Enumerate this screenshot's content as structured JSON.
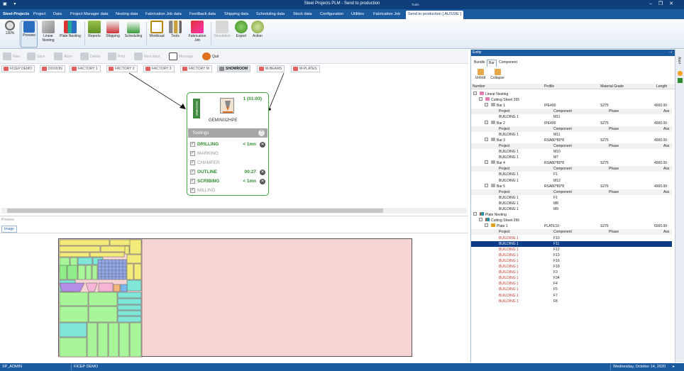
{
  "window": {
    "title": "Steel Projects PLM - Send to production",
    "context_title": "Tools",
    "controls": [
      "–",
      "❐",
      "✕"
    ]
  },
  "menu": {
    "app_tab": "Steel-Projects",
    "tabs": [
      "Project",
      "Data",
      "Project Manager data",
      "Nesting data",
      "Fabrication Job data",
      "Feedback data",
      "Shipping data",
      "Scheduling data",
      "Stock data",
      "Configuration",
      "Utilities",
      "Fabrication Job"
    ],
    "active_tab": "Send to production [ AUSSIE ]"
  },
  "ribbon": {
    "zoom": "130%",
    "buttons": [
      {
        "label": "Preview",
        "icon": "preview-icon"
      },
      {
        "label": "Linear Nesting",
        "icon": "linear-nesting-icon"
      },
      {
        "label": "Plate Nesting",
        "icon": "plate-nesting-icon"
      },
      {
        "label": "Reports",
        "icon": "reports-icon"
      },
      {
        "label": "Shipping",
        "icon": "shipping-icon"
      },
      {
        "label": "Scheduling",
        "icon": "scheduling-icon"
      },
      {
        "label": "Workload",
        "icon": "workload-icon"
      },
      {
        "label": "Tools",
        "icon": "tools-icon"
      },
      {
        "label": "Fabrication Job",
        "icon": "fabrication-job-icon"
      },
      {
        "label": "Simulation",
        "icon": "simulation-icon"
      },
      {
        "label": "Export",
        "icon": "export-icon"
      },
      {
        "label": "Action",
        "icon": "action-icon"
      }
    ]
  },
  "commands": [
    "New",
    "Save",
    "Abort",
    "Delete",
    "Print",
    "Next input",
    "Message",
    "Quit"
  ],
  "factory_tabs": [
    "FICEP DEMO",
    "DOXION",
    "FACTORY 1",
    "FACTORY 2",
    "FACTORY 3",
    "FACTORY M",
    "SHOWROOM",
    "M-BEAMS",
    "M-PLATES"
  ],
  "active_factory": "SHOWROOM",
  "machine": {
    "name": "GEMINI32HPE",
    "count": "1 (01:03)",
    "thumb_label": "MACHINE",
    "toolings_label": "Toolings",
    "toolings": [
      {
        "name": "DRILLING",
        "time": "< 1mn",
        "active": true
      },
      {
        "name": "MARKING",
        "time": "",
        "active": false
      },
      {
        "name": "CHAMFER",
        "time": "",
        "active": false
      },
      {
        "name": "OUTLINE",
        "time": "00:27",
        "active": true
      },
      {
        "name": "SCRIBING",
        "time": "< 1mn",
        "active": true
      },
      {
        "name": "MILLING",
        "time": "",
        "active": false
      }
    ]
  },
  "preview": {
    "label": "Preview",
    "tab": "Image"
  },
  "entity": {
    "title": "Entity",
    "tabs": [
      "Bundle",
      "Bar",
      "Component"
    ],
    "active_tab": "Bar",
    "buttons": [
      "Unfold",
      "Collapse"
    ],
    "columns": [
      "Number",
      "Profile",
      "Material Grade",
      "Length"
    ],
    "sub_columns": [
      "Project",
      "Component",
      "Phase",
      "Ass"
    ],
    "linear_nesting": "Linear Nesting",
    "cutting_sheet_1": "Cutting Sheet 265",
    "bars": [
      {
        "name": "Bar 1",
        "profile": "IPE400",
        "grade": "S275",
        "length": "4000.00",
        "items": [
          {
            "project": "BUILDING 1",
            "component": "M11"
          }
        ]
      },
      {
        "name": "Bar 2",
        "profile": "IPE400",
        "grade": "S275",
        "length": "4000.00",
        "items": [
          {
            "project": "BUILDING 1",
            "component": "M11"
          }
        ]
      },
      {
        "name": "Bar 3",
        "profile": "RSA80*80*8",
        "grade": "S275",
        "length": "4000.00",
        "items": [
          {
            "project": "BUILDING 1",
            "component": "M10"
          },
          {
            "project": "BUILDING 1",
            "component": "M7"
          }
        ]
      },
      {
        "name": "Bar 4",
        "profile": "RSA80*80*8",
        "grade": "S275",
        "length": "4000.00",
        "items": [
          {
            "project": "BUILDING 1",
            "component": "F1"
          },
          {
            "project": "BUILDING 1",
            "component": "M12"
          }
        ]
      },
      {
        "name": "Bar 5",
        "profile": "RSA80*80*8",
        "grade": "S275",
        "length": "4000.00",
        "items": [
          {
            "project": "BUILDING 1",
            "component": "F1"
          },
          {
            "project": "BUILDING 1",
            "component": "M8"
          },
          {
            "project": "BUILDING 1",
            "component": "M9"
          }
        ]
      }
    ],
    "plate_nesting": "Plate Nesting",
    "cutting_sheet_2": "Cutting Sheet 266",
    "plate": {
      "name": "Plate 1",
      "profile": "PLATE10",
      "grade": "S275",
      "length": "6000.00"
    },
    "plate_items": [
      "F10",
      "F11",
      "F12",
      "F13",
      "F16",
      "F18",
      "F3",
      "F34",
      "F4",
      "F5",
      "F7",
      "F8"
    ],
    "plate_project": "BUILDING 1",
    "selected_component": "F11"
  },
  "side_strip": "Alert",
  "status": {
    "user": "SP_ADMIN",
    "company": "FICEP DEMO",
    "date": "Wednesday, October 14, 2020"
  },
  "colors": {
    "accent": "#1c5aa0",
    "tooling_active": "#2e8b2e",
    "card_border": "#41a541",
    "sheet": "#f7d4d4",
    "selection": "#0a3c8a"
  }
}
